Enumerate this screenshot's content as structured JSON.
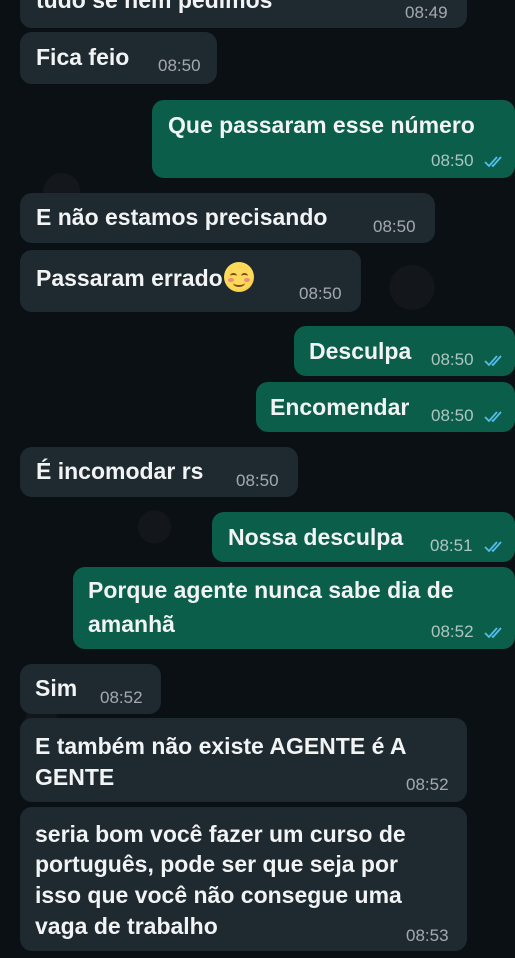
{
  "messages": [
    {
      "id": "m0",
      "dir": "in",
      "text": "tudo se nem pedimos",
      "time": "08:49"
    },
    {
      "id": "m1",
      "dir": "in",
      "text": "Fica feio",
      "time": "08:50"
    },
    {
      "id": "m2",
      "dir": "out",
      "text": "Que passaram esse número",
      "time": "08:50"
    },
    {
      "id": "m3",
      "dir": "in",
      "text": "E não estamos precisando",
      "time": "08:50"
    },
    {
      "id": "m4",
      "dir": "in",
      "text": "Passaram errado",
      "emoji": "smiling-blush-emoji",
      "time": "08:50"
    },
    {
      "id": "m5",
      "dir": "out",
      "text": "Desculpa",
      "time": "08:50"
    },
    {
      "id": "m6",
      "dir": "out",
      "text": "Encomendar",
      "time": "08:50"
    },
    {
      "id": "m7",
      "dir": "in",
      "text": "É incomodar rs",
      "time": "08:50"
    },
    {
      "id": "m8",
      "dir": "out",
      "text": "Nossa desculpa",
      "time": "08:51"
    },
    {
      "id": "m9",
      "dir": "out",
      "lines": [
        "Porque agente nunca sabe dia de",
        "amanhã"
      ],
      "time": "08:52"
    },
    {
      "id": "m10",
      "dir": "in",
      "text": "Sim",
      "time": "08:52"
    },
    {
      "id": "m11",
      "dir": "in",
      "lines": [
        "E também não existe AGENTE é A",
        "GENTE"
      ],
      "time": "08:52"
    },
    {
      "id": "m12",
      "dir": "in",
      "lines": [
        "seria bom você fazer um curso de",
        "português, pode ser que seja por",
        "isso que você não consegue uma",
        "vaga de trabalho"
      ],
      "time": "08:53"
    }
  ],
  "colors": {
    "background": "#0b1014",
    "incoming_bubble": "#1f2a30",
    "outgoing_bubble": "#0b5e4a",
    "read_ticks": "#53bdeb"
  },
  "icons": {
    "read_receipt": "double-check-icon"
  }
}
